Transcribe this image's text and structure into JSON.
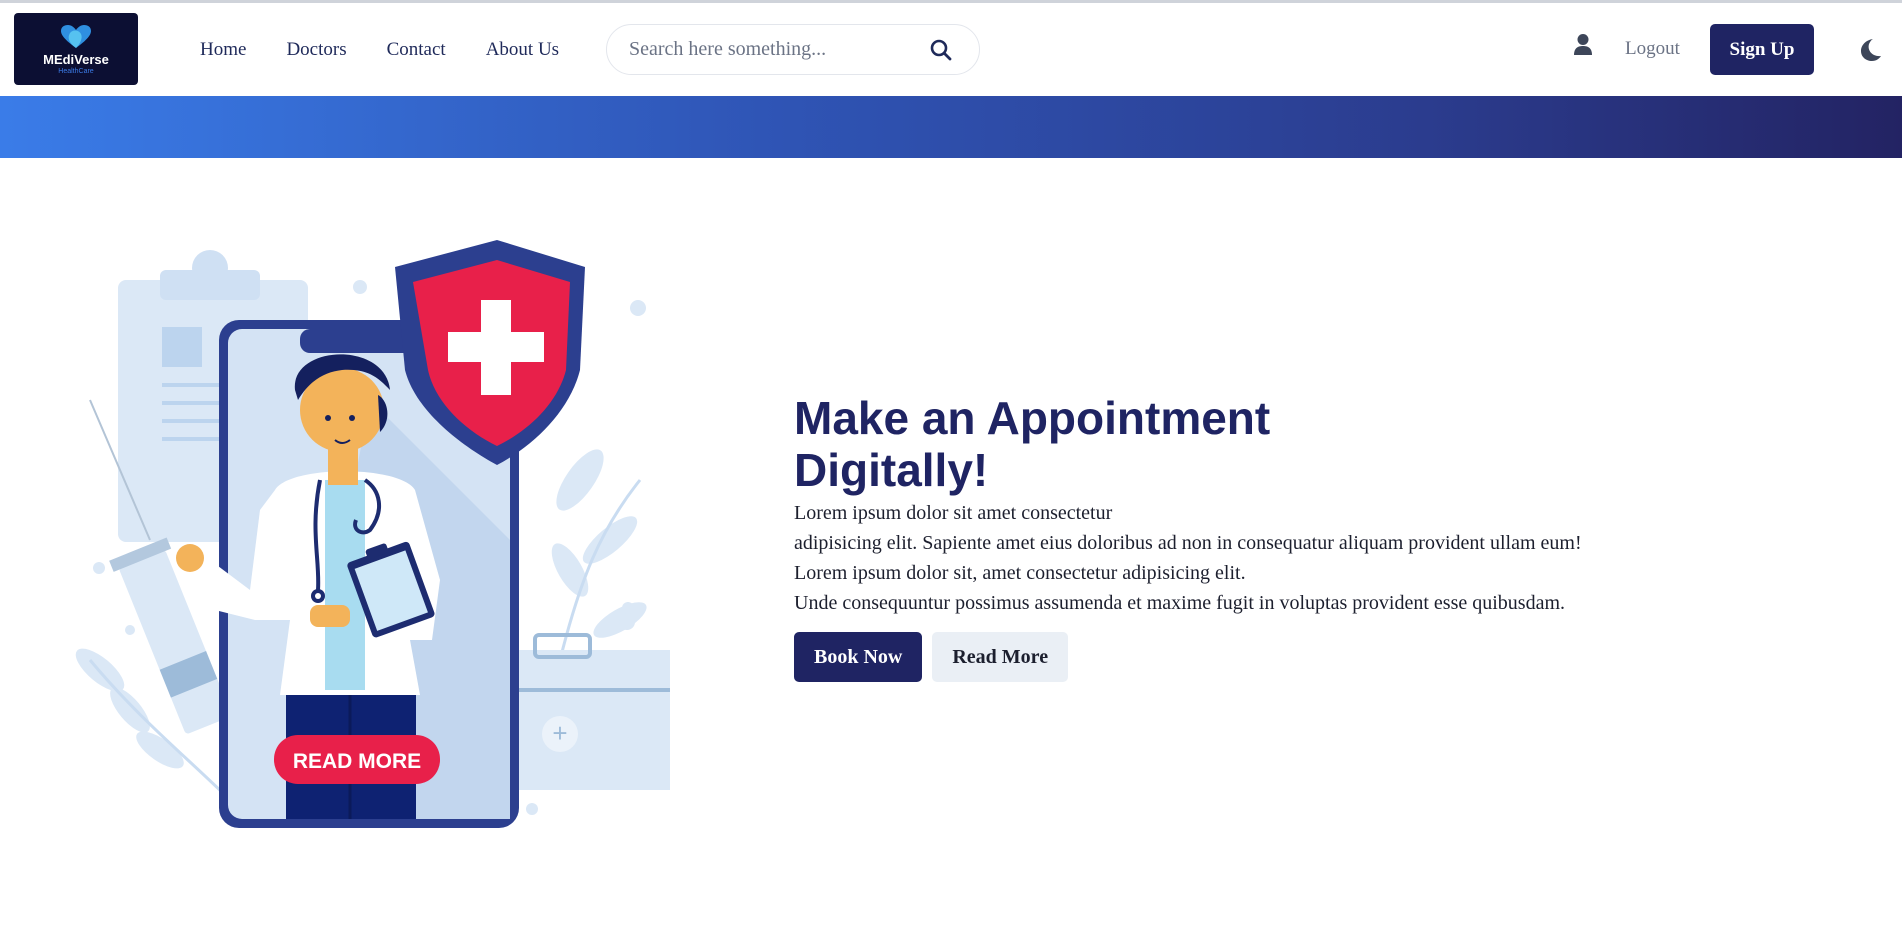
{
  "brand": {
    "name": "MEdiVerse",
    "tagline": "HealthCare",
    "colors": {
      "primary": "#1f2463",
      "accent": "#3a7ce8",
      "logo_bg": "#0c0f33",
      "danger": "#e8204a"
    }
  },
  "nav": {
    "links": [
      "Home",
      "Doctors",
      "Contact",
      "About Us"
    ],
    "search": {
      "placeholder": "Search here something...",
      "value": "",
      "icon": "search-icon"
    },
    "user_icon": "user-icon",
    "logout_label": "Logout",
    "signup_label": "Sign Up",
    "theme_icon": "moon-icon"
  },
  "hero": {
    "title": "Make an Appointment",
    "subtitle": "Digitally!",
    "paragraph_lines": [
      "Lorem ipsum dolor sit amet consectetur",
      "adipisicing elit. Sapiente amet eius doloribus ad non in consequatur aliquam provident ullam eum!",
      "Lorem ipsum dolor sit, amet consectetur adipisicing elit.",
      "Unde consequuntur possimus assumenda et maxime fugit in voluptas provident esse quibusdam."
    ],
    "book_label": "Book Now",
    "read_more_label": "Read More",
    "illustration_button_label": "READ MORE"
  }
}
